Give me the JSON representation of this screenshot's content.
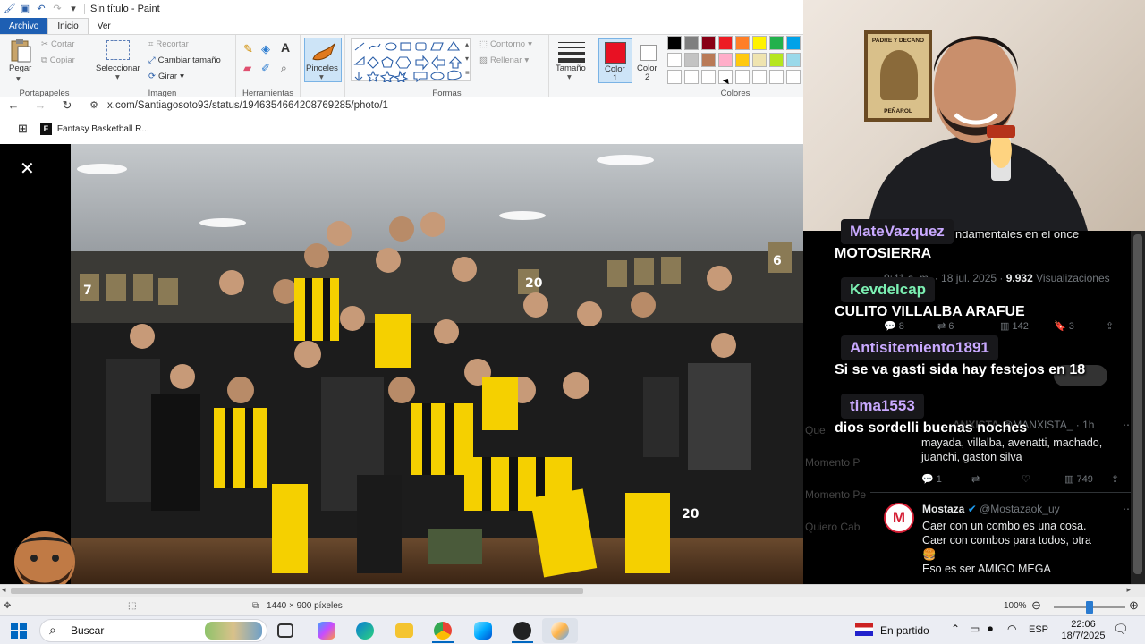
{
  "window": {
    "title": "Sin título - Paint"
  },
  "menu": {
    "file": "Archivo",
    "home": "Inicio",
    "view": "Ver"
  },
  "ribbon": {
    "clipboard": {
      "paste": "Pegar",
      "cut": "Cortar",
      "copy": "Copiar",
      "label": "Portapapeles"
    },
    "image": {
      "select": "Seleccionar",
      "crop": "Recortar",
      "resize": "Cambiar tamaño",
      "rotate": "Girar",
      "label": "Imagen"
    },
    "tools": {
      "label": "Herramientas"
    },
    "brushes": {
      "label": "Pinceles"
    },
    "shapes": {
      "outline": "Contorno",
      "fill": "Rellenar",
      "label": "Formas"
    },
    "size": {
      "label": "Tamaño"
    },
    "color1": {
      "label": "Color",
      "num": "1",
      "value": "#e81123"
    },
    "color2": {
      "label": "Color",
      "num": "2",
      "value": "#ffffff"
    },
    "colors": {
      "label": "Colores",
      "row1": [
        "#000000",
        "#7f7f7f",
        "#880015",
        "#ed1c24",
        "#ff7f27",
        "#fff200",
        "#22b14c",
        "#00a2e8"
      ],
      "row2": [
        "#ffffff",
        "#c3c3c3",
        "#b97a57",
        "#ffaec9",
        "#ffc90e",
        "#efe4b0",
        "#b5e61d",
        "#99d9ea"
      ]
    }
  },
  "browser": {
    "url": "x.com/Santiagosoto93/status/1946354664208769285/photo/1",
    "bookmark": "Fantasy Basketball R..."
  },
  "status": {
    "dimensions": "1440 × 900 píxeles",
    "zoom": "100%",
    "zoom_fraction": 0.5
  },
  "twitter": {
    "snippet": "ndamentales en el once",
    "meta_prefix": "9:41 a. m. · 18 jul. 2025 · ",
    "meta_views": "9.932",
    "meta_views_label": "Visualizaciones",
    "stats": {
      "replies": "8",
      "reposts": "6",
      "views": "142",
      "bookmarks": "3"
    },
    "reply1": {
      "name": "ANXISTA",
      "handle": "@MANXISTA_",
      "time": "· 1h",
      "text1": "mayada, villalba, avenatti, machado,",
      "text2": "juanchi, gaston silva"
    },
    "reply1_stats": {
      "replies": "1",
      "views": "749"
    },
    "tweet": {
      "name": "Mostaza",
      "handle": "@Mostazaok_uy",
      "line1": "Caer con un combo es una cosa.",
      "line2": "Caer con combos para todos, otra",
      "line3": "🍔",
      "line4": "Eso es ser AMIGO MEGA",
      "avatar_letter": "M"
    },
    "left_faded": [
      "Que",
      "Momento P",
      "Momento Pe",
      "Quiero Cab"
    ]
  },
  "chat": [
    {
      "user": "MateVazquez",
      "color": "#c9a9ff",
      "msg": "MOTOSIERRA"
    },
    {
      "user": "Kevdelcap",
      "color": "#7cf0b3",
      "msg": "CULITO VILLALBA ARAFUE"
    },
    {
      "user": "Antisitemiento1891",
      "color": "#c9a9ff",
      "msg": "Si se va gasti sida hay festejos en 18"
    },
    {
      "user": "tima1553",
      "color": "#c9a9ff",
      "msg": "dios sordelli buenas noches"
    }
  ],
  "webcam": {
    "poster_text1": "PADRE Y DECANO",
    "poster_text2": "PEÑAROL"
  },
  "taskbar": {
    "search": "Buscar",
    "sport": "En partido",
    "lang": "ESP",
    "time": "22:06",
    "date": "18/7/2025"
  }
}
